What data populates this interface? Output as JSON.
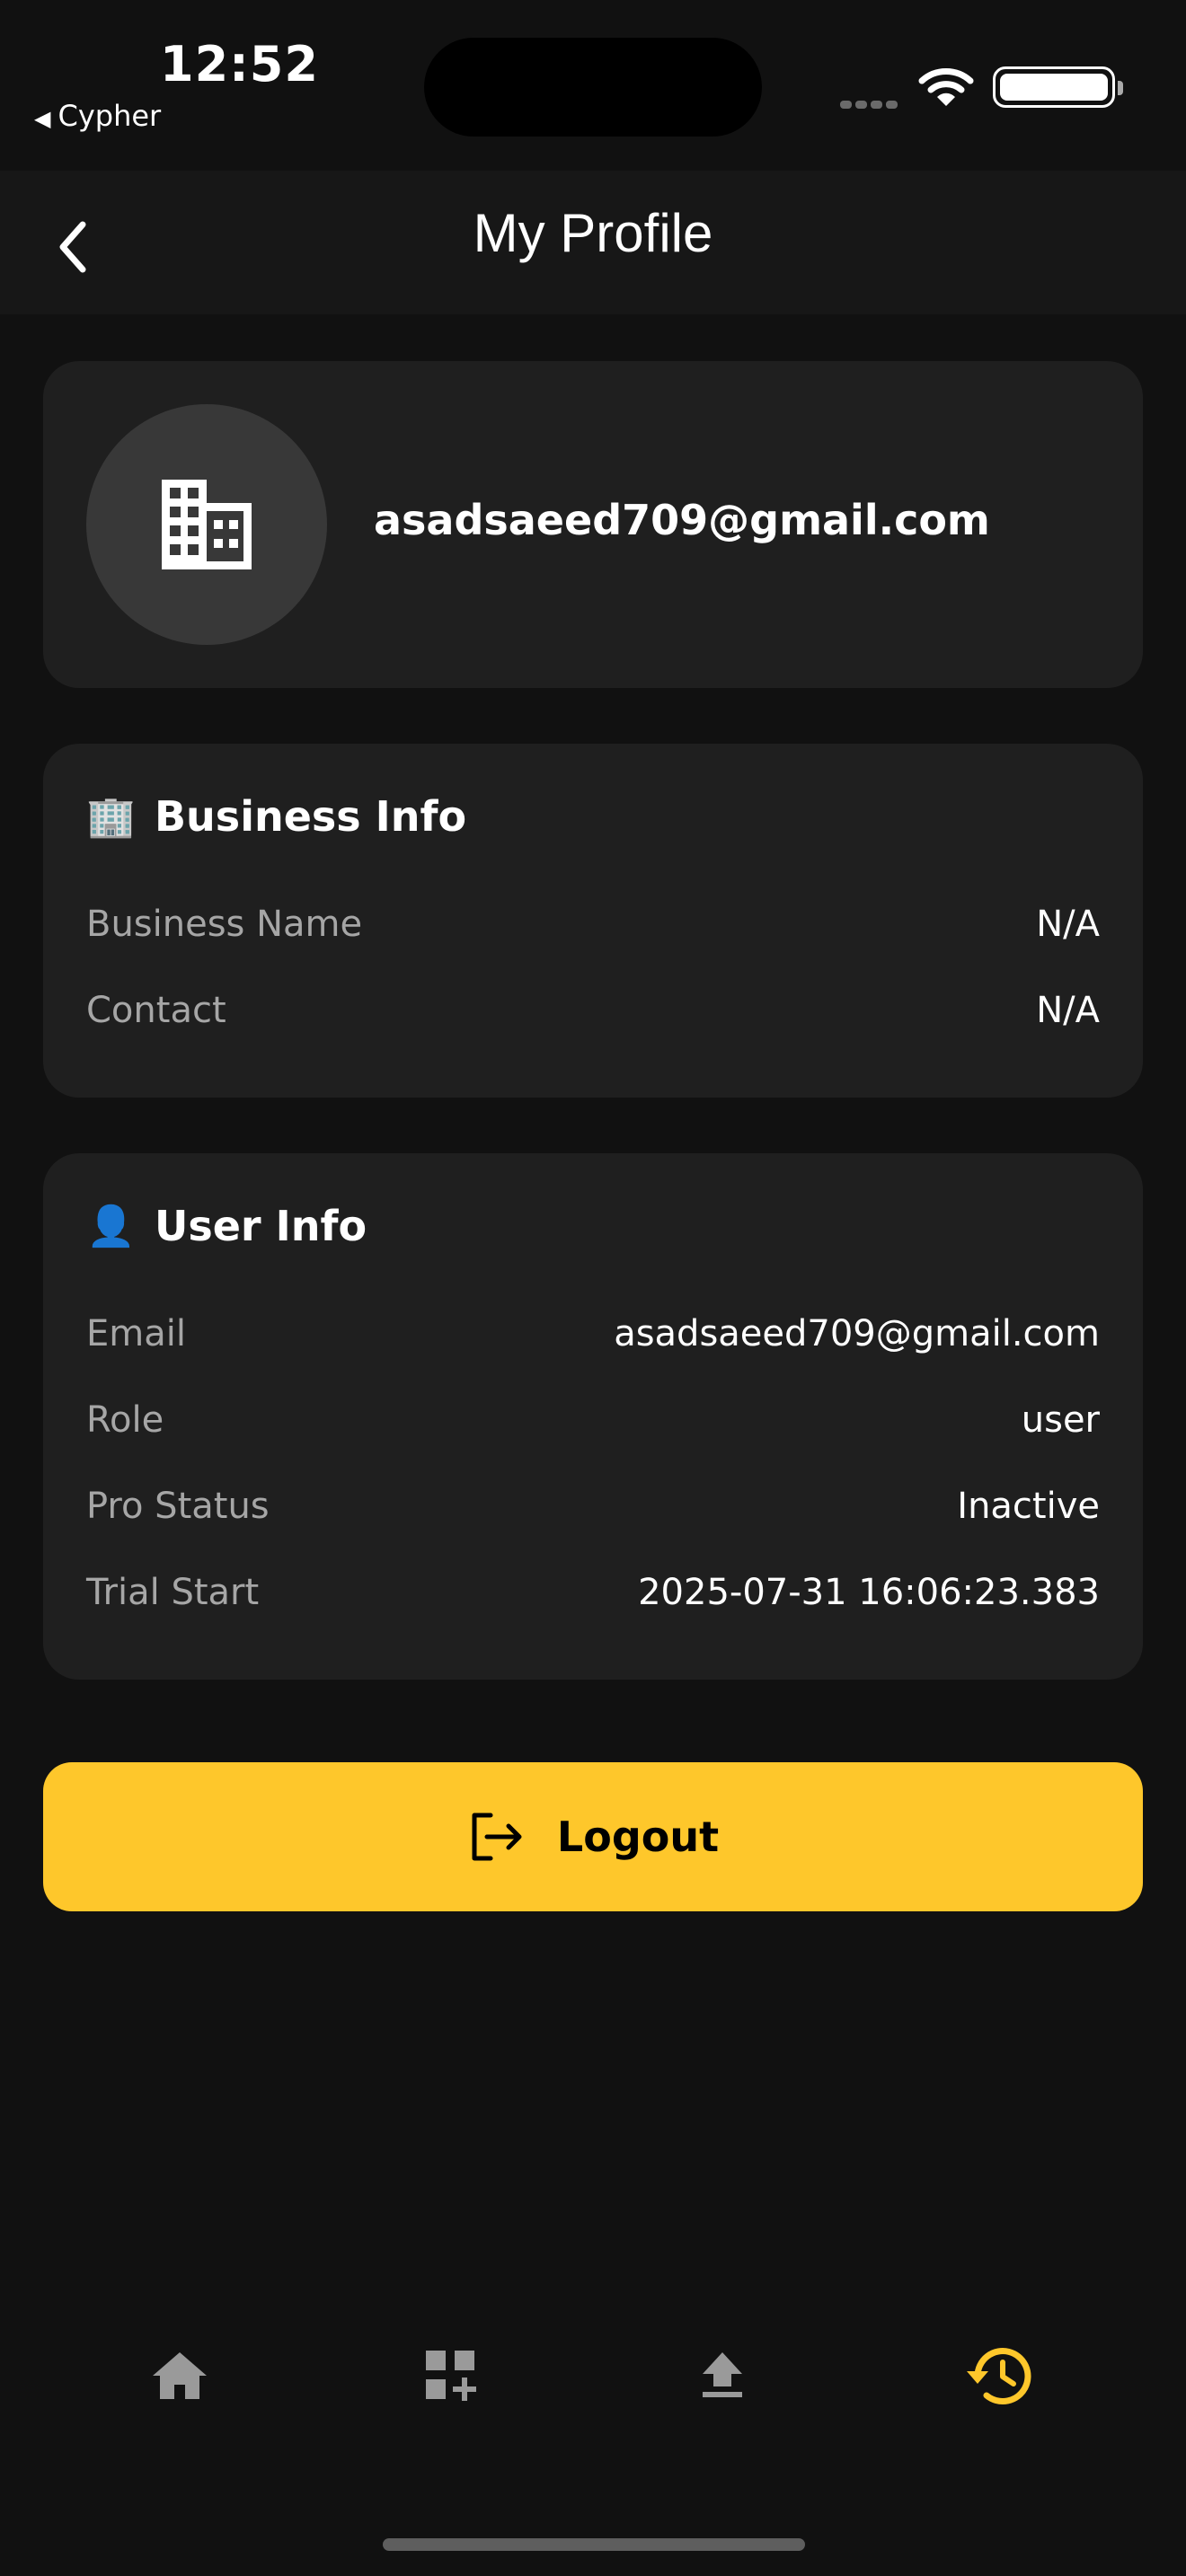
{
  "status_bar": {
    "time": "12:52",
    "back_app": "Cypher"
  },
  "header": {
    "title": "My Profile"
  },
  "profile": {
    "email": "asadsaeed709@gmail.com"
  },
  "business_info": {
    "emoji": "🏢",
    "title": "Business Info",
    "rows": [
      {
        "label": "Business Name",
        "value": "N/A"
      },
      {
        "label": "Contact",
        "value": "N/A"
      }
    ]
  },
  "user_info": {
    "emoji": "👤",
    "title": "User Info",
    "rows": [
      {
        "label": "Email",
        "value": "asadsaeed709@gmail.com"
      },
      {
        "label": "Role",
        "value": "user"
      },
      {
        "label": "Pro Status",
        "value": "Inactive"
      },
      {
        "label": "Trial Start",
        "value": "2025-07-31 16:06:23.383"
      }
    ]
  },
  "logout": {
    "label": "Logout"
  },
  "bottom_nav": {
    "items": [
      {
        "icon": "home-icon",
        "active": false
      },
      {
        "icon": "grid-add-icon",
        "active": false
      },
      {
        "icon": "upload-icon",
        "active": false
      },
      {
        "icon": "history-icon",
        "active": true
      }
    ]
  },
  "colors": {
    "background": "#111111",
    "card": "#1f1f1f",
    "accent": "#fec72b",
    "muted_text": "#a6a6a6",
    "inactive_icon": "#9a9a9a"
  }
}
